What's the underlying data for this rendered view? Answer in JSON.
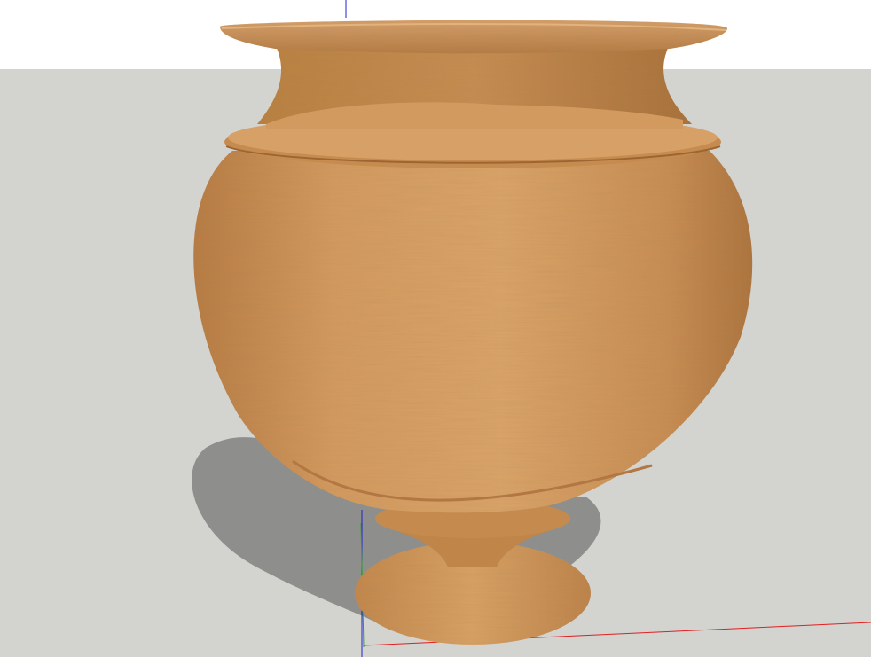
{
  "viewport": {
    "sky_color": "#ffffff",
    "ground_color": "#d3d3d0",
    "shadow_color": "#8e8e8c",
    "axis_colors": {
      "red": "#e02020",
      "green": "#30a030",
      "blue": "#2020d0"
    }
  },
  "model": {
    "material_base": "#c98f55",
    "material_light": "#dca56c",
    "material_dark": "#a06a35"
  }
}
